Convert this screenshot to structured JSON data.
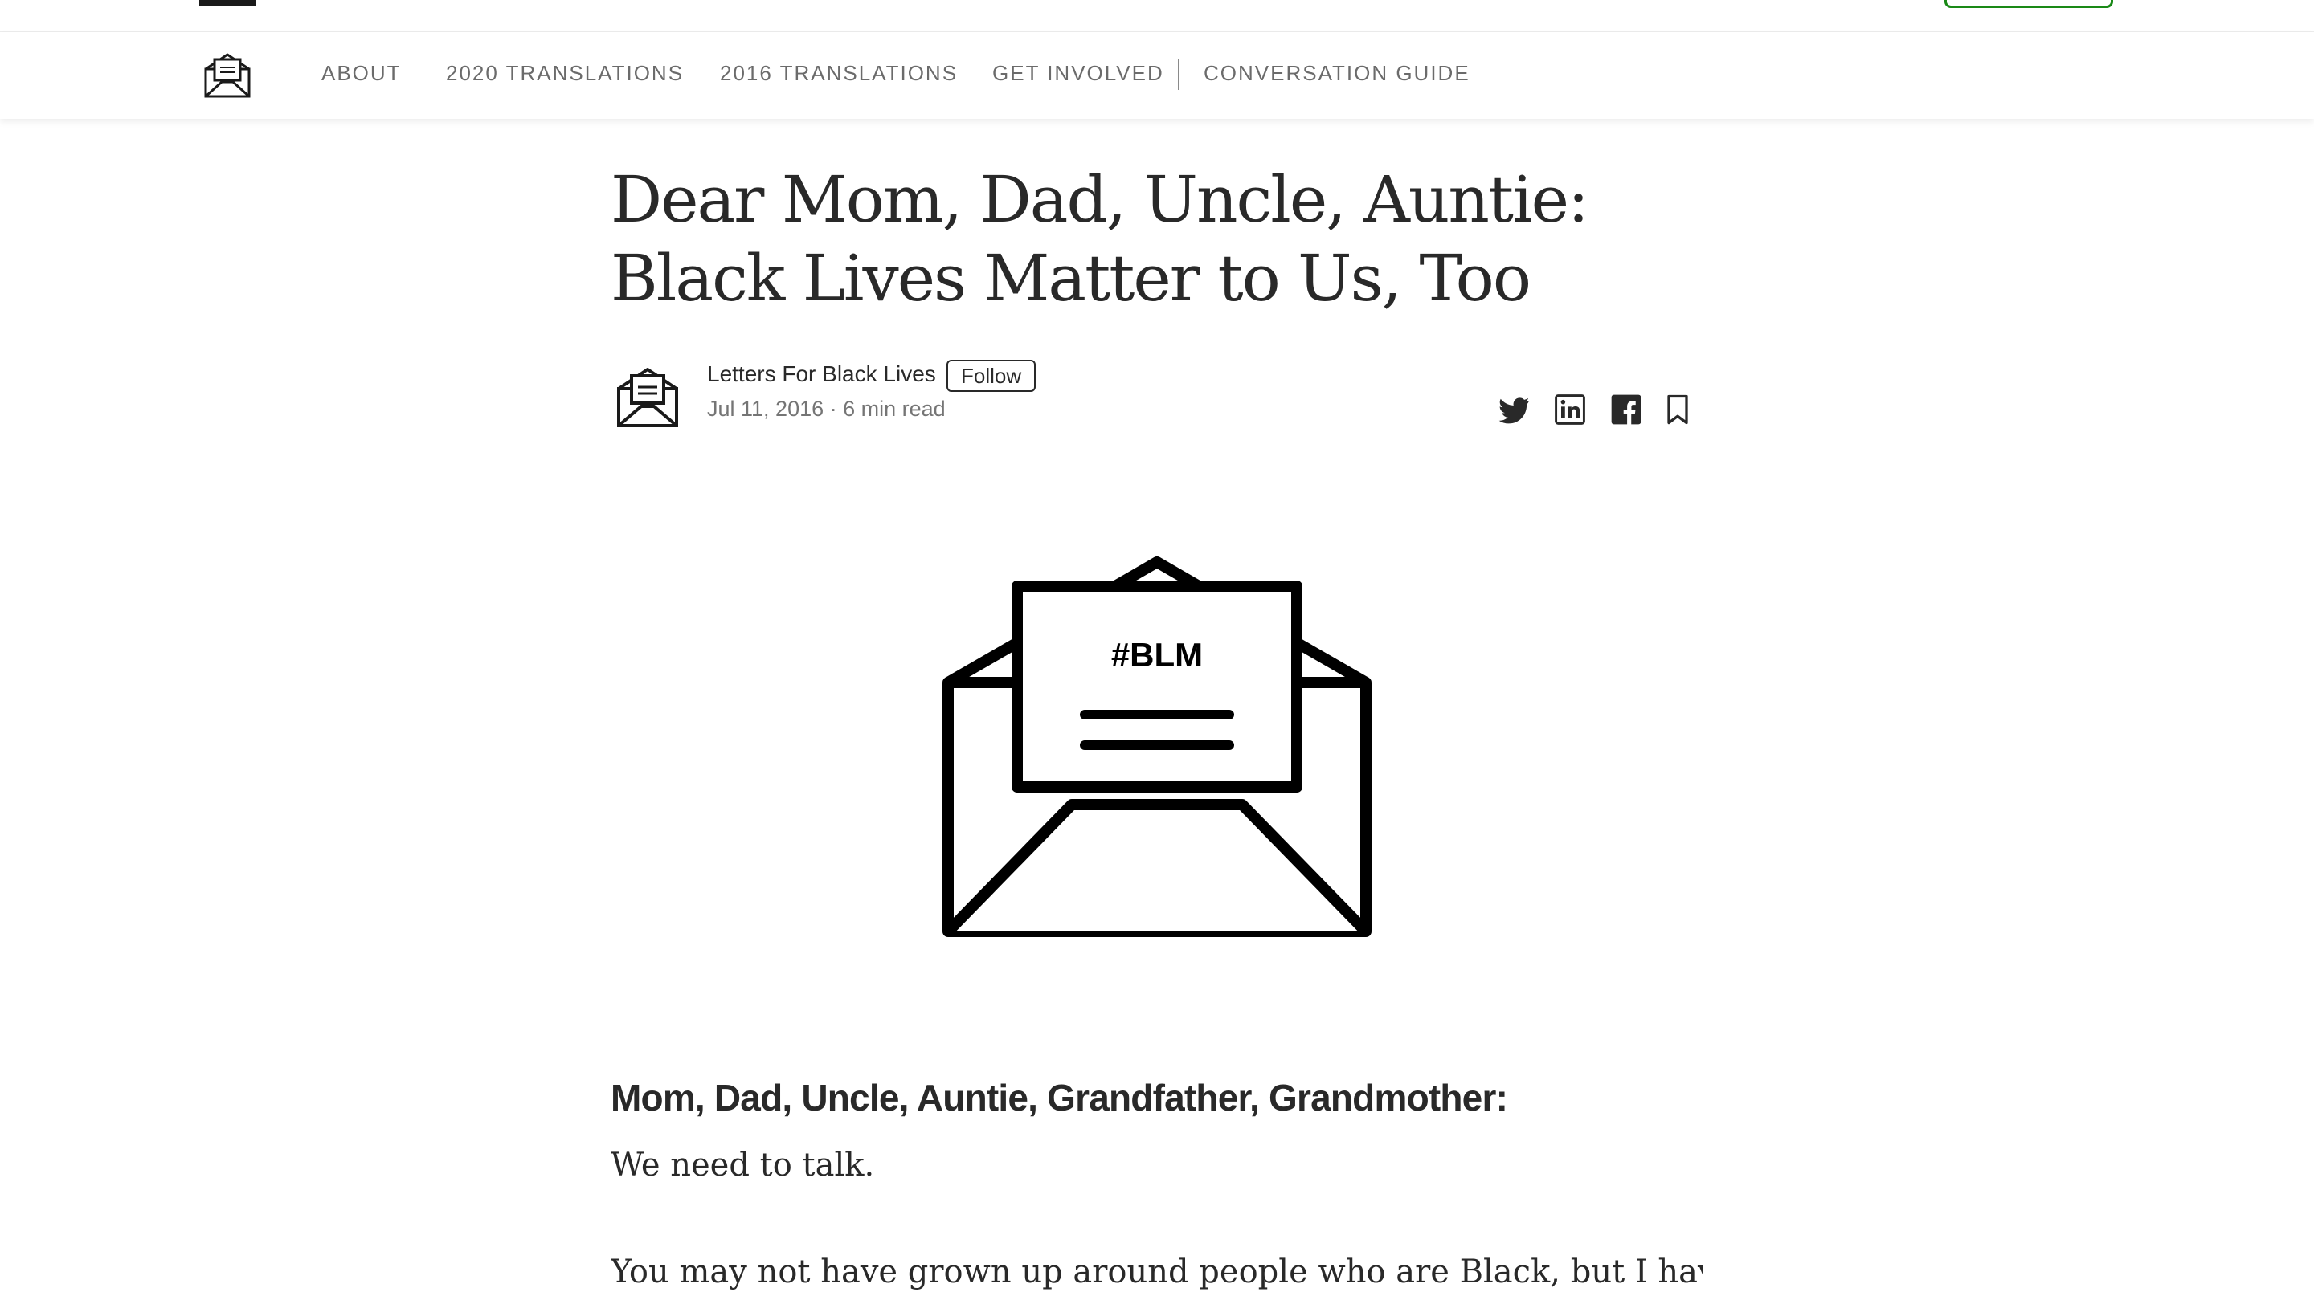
{
  "nav": {
    "items": [
      {
        "label": "ABOUT"
      },
      {
        "label": "2020 TRANSLATIONS"
      },
      {
        "label": "2016 TRANSLATIONS"
      },
      {
        "label": "GET INVOLVED"
      },
      {
        "label": "CONVERSATION GUIDE"
      }
    ],
    "logo_icon": "envelope-letter-icon"
  },
  "article": {
    "title": "Dear Mom, Dad, Uncle, Auntie: Black Lives Matter to Us, Too",
    "author": "Letters For Black Lives",
    "follow_label": "Follow",
    "meta": "Jul 11, 2016 · 6 min read",
    "hero_text": "#BLM",
    "salutation": "Mom, Dad, Uncle, Auntie, Grandfather, Grandmother:",
    "paragraph_1": "We need to talk.",
    "paragraph_2": "You may not have grown up around people who are Black, but I have. Black"
  },
  "share": {
    "icons": [
      "twitter-icon",
      "linkedin-icon",
      "facebook-icon",
      "bookmark-icon"
    ]
  },
  "colors": {
    "text": "#292929",
    "muted": "#757575",
    "nav_text": "#6b6b6b",
    "accent_green": "#1a8917"
  }
}
